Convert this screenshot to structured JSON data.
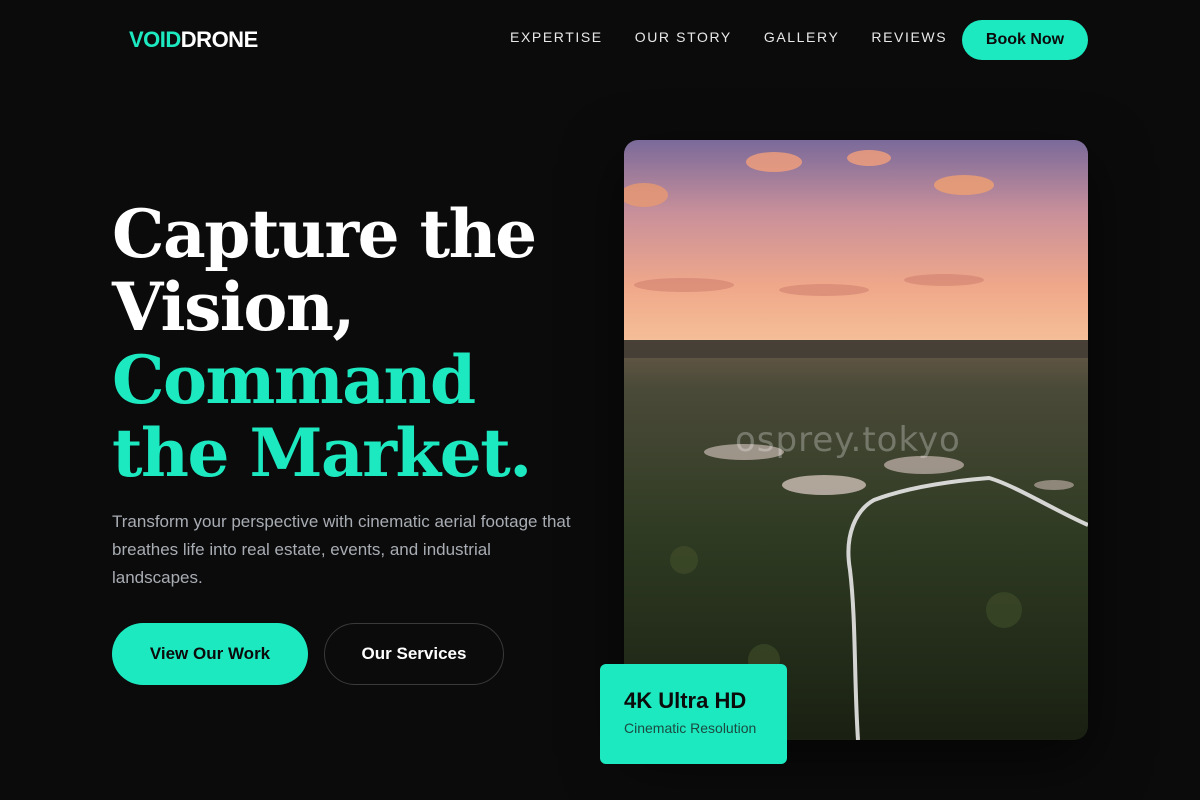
{
  "brand": {
    "part1": "VOID",
    "part2": "DRONE"
  },
  "nav": {
    "items": [
      "EXPERTISE",
      "OUR STORY",
      "GALLERY",
      "REVIEWS"
    ],
    "cta": "Book Now"
  },
  "hero": {
    "title_line1": "Capture the",
    "title_line2": "Vision,",
    "title_line3": "Command",
    "title_line4": "the Market.",
    "description": "Transform your perspective with cinematic aerial footage that breathes life into real estate, events, and industrial landscapes.",
    "primary_cta": "View Our Work",
    "secondary_cta": "Our Services"
  },
  "image": {
    "watermark": "osprey.tokyo"
  },
  "badge": {
    "title": "4K Ultra HD",
    "subtitle": "Cinematic Resolution"
  },
  "colors": {
    "accent": "#1de9c1",
    "background": "#0b0b0b",
    "muted_text": "#a8acb3"
  }
}
